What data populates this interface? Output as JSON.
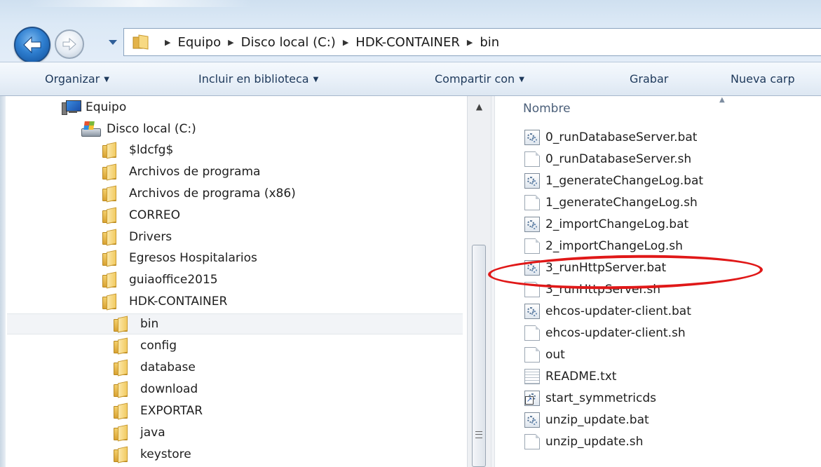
{
  "breadcrumb": {
    "items": [
      {
        "label": "Equipo"
      },
      {
        "label": "Disco local (C:)"
      },
      {
        "label": "HDK-CONTAINER"
      },
      {
        "label": "bin"
      }
    ]
  },
  "toolbar": {
    "organize_label": "Organizar",
    "include_label": "Incluir en biblioteca",
    "share_label": "Compartir con",
    "burn_label": "Grabar",
    "new_folder_label": "Nueva carp"
  },
  "nav": {
    "computer_label": "Equipo",
    "drive_label": "Disco local (C:)",
    "folders": [
      {
        "label": "$ldcfg$"
      },
      {
        "label": "Archivos de programa"
      },
      {
        "label": "Archivos de programa (x86)"
      },
      {
        "label": "CORREO"
      },
      {
        "label": "Drivers"
      },
      {
        "label": "Egresos Hospitalarios"
      },
      {
        "label": "guiaoffice2015"
      },
      {
        "label": "HDK-CONTAINER"
      }
    ],
    "subfolders": [
      {
        "label": "bin",
        "selected": true
      },
      {
        "label": "config"
      },
      {
        "label": "database"
      },
      {
        "label": "download"
      },
      {
        "label": "EXPORTAR"
      },
      {
        "label": "java"
      },
      {
        "label": "keystore"
      }
    ]
  },
  "filelist": {
    "column_name": "Nombre",
    "files": [
      {
        "name": "0_runDatabaseServer.bat",
        "icon": "batch-file-icon"
      },
      {
        "name": "0_runDatabaseServer.sh",
        "icon": "file-icon"
      },
      {
        "name": "1_generateChangeLog.bat",
        "icon": "batch-file-icon"
      },
      {
        "name": "1_generateChangeLog.sh",
        "icon": "file-icon"
      },
      {
        "name": "2_importChangeLog.bat",
        "icon": "batch-file-icon"
      },
      {
        "name": "2_importChangeLog.sh",
        "icon": "file-icon"
      },
      {
        "name": "3_runHttpServer.bat",
        "icon": "batch-file-icon"
      },
      {
        "name": "3_runHttpServer.sh",
        "icon": "file-icon"
      },
      {
        "name": "ehcos-updater-client.bat",
        "icon": "batch-file-icon"
      },
      {
        "name": "ehcos-updater-client.sh",
        "icon": "file-icon"
      },
      {
        "name": "out",
        "icon": "file-icon"
      },
      {
        "name": "README.txt",
        "icon": "text-file-icon"
      },
      {
        "name": "start_symmetricds",
        "icon": "shortcut-icon"
      },
      {
        "name": "unzip_update.bat",
        "icon": "batch-file-icon"
      },
      {
        "name": "unzip_update.sh",
        "icon": "file-icon"
      }
    ]
  },
  "colors": {
    "annotation": "#e01818",
    "command_text": "#1e395b",
    "header_text": "#4c607a"
  }
}
